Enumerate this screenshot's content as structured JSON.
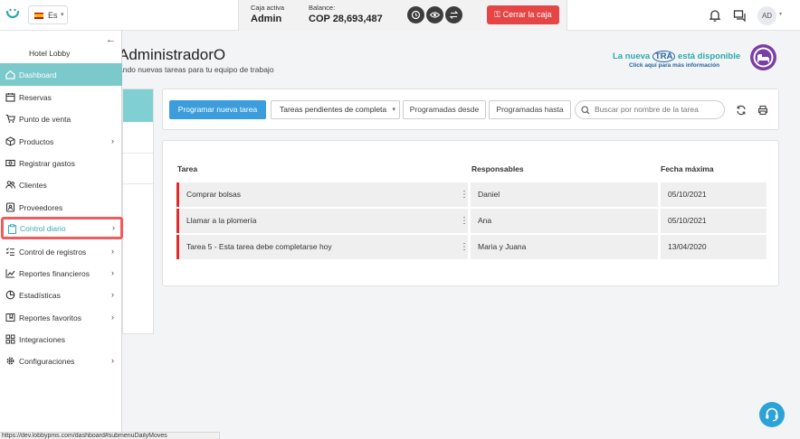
{
  "topbar": {
    "language": "Es",
    "cashbox_label": "Caja activa",
    "cashbox_user": "Admin",
    "balance_label": "Balance:",
    "balance_value": "COP 28,693,487",
    "close_button": "Cerrar la caja",
    "avatar_initials": "AD"
  },
  "sidebar": {
    "hotel_name": "Hotel Lobby",
    "items": [
      {
        "label": "Dashboard",
        "icon": "home-icon",
        "active": true
      },
      {
        "label": "Reservas",
        "icon": "calendar-icon"
      },
      {
        "label": "Punto de venta",
        "icon": "cart-icon"
      },
      {
        "label": "Productos",
        "icon": "box-icon",
        "has_submenu": true
      },
      {
        "label": "Registrar gastos",
        "icon": "money-icon"
      },
      {
        "label": "Clientes",
        "icon": "users-icon"
      },
      {
        "label": "Proveedores",
        "icon": "address-book-icon"
      },
      {
        "label": "Control diario",
        "icon": "clipboard-icon",
        "has_submenu": true,
        "highlighted": true
      },
      {
        "label": "Control de registros",
        "icon": "list-check-icon",
        "has_submenu": true
      },
      {
        "label": "Reportes financieros",
        "icon": "chart-line-icon",
        "has_submenu": true
      },
      {
        "label": "Estadísticas",
        "icon": "pie-chart-icon",
        "has_submenu": true
      },
      {
        "label": "Reportes favoritos",
        "icon": "bookmark-icon",
        "has_submenu": true
      },
      {
        "label": "Integraciones",
        "icon": "grid-icon"
      },
      {
        "label": "Configuraciones",
        "icon": "gear-icon",
        "has_submenu": true
      }
    ]
  },
  "header": {
    "title": "AdministradorO",
    "subtitle": "ando nuevas tareas para tu equipo de trabajo"
  },
  "banner": {
    "prefix": "La nueva",
    "tra": "TRA",
    "suffix": "está disponible",
    "sub": "Click aquí para más información"
  },
  "filters": {
    "new_task_button": "Programar nueva tarea",
    "status_select": "Tareas pendientes de completa",
    "date_from": "Programadas desde",
    "date_to": "Programadas hasta",
    "search_placeholder": "Buscar por nombre de la tarea"
  },
  "table": {
    "columns": [
      "Tarea",
      "Responsables",
      "Fecha máxima"
    ],
    "rows": [
      {
        "task": "Comprar bolsas",
        "responsables": "Daniel",
        "date": "05/10/2021"
      },
      {
        "task": "Llamar a la plomería",
        "responsables": "Ana",
        "date": "05/10/2021"
      },
      {
        "task": "Tarea 5 - Esta tarea debe completarse hoy",
        "responsables": "Maria y Juana",
        "date": "13/04/2020"
      }
    ]
  },
  "status_bar_url": "https://dev.lobbypms.com/dashboard#submenuDailyMoves",
  "colors": {
    "accent": "#7cc9cc",
    "primary_button": "#3b9ddc",
    "danger": "#e54545",
    "row_marker": "#e02b2b"
  }
}
